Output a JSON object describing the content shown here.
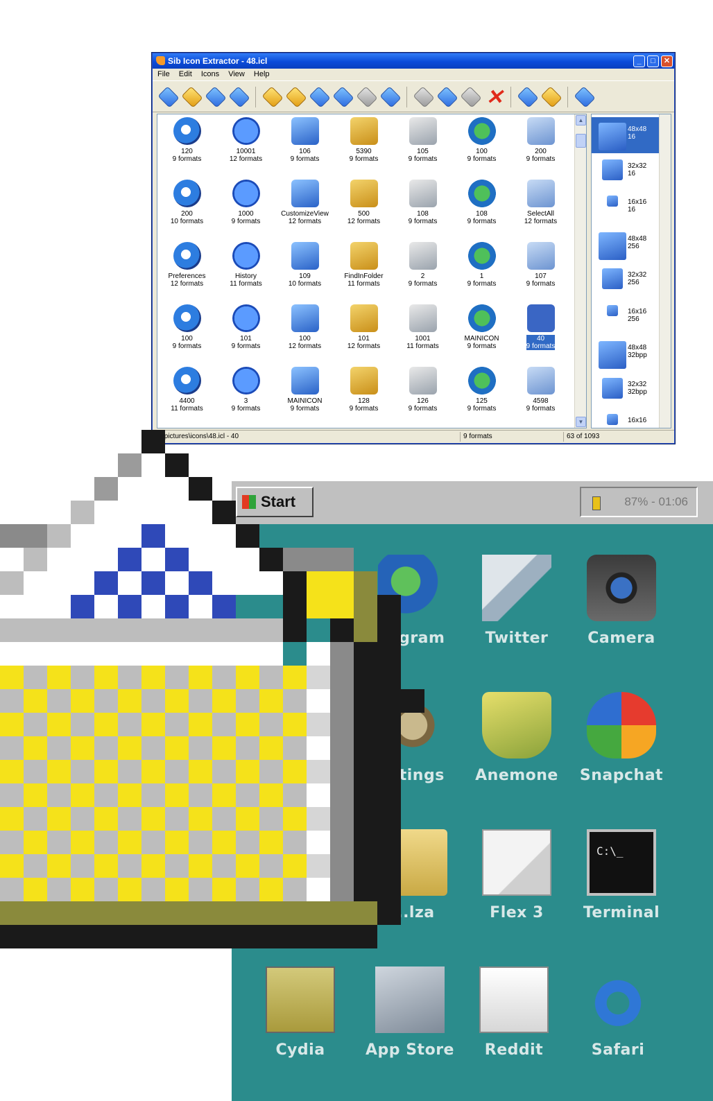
{
  "window": {
    "title": "Sib Icon Extractor - 48.icl",
    "menu": [
      "File",
      "Edit",
      "Icons",
      "View",
      "Help"
    ],
    "icons": [
      {
        "name": "120",
        "formats": "9 formats"
      },
      {
        "name": "10001",
        "formats": "12 formats"
      },
      {
        "name": "106",
        "formats": "9 formats"
      },
      {
        "name": "5390",
        "formats": "9 formats"
      },
      {
        "name": "105",
        "formats": "9 formats"
      },
      {
        "name": "100",
        "formats": "9 formats"
      },
      {
        "name": "200",
        "formats": "9 formats"
      },
      {
        "name": "200",
        "formats": "10 formats"
      },
      {
        "name": "1000",
        "formats": "9 formats"
      },
      {
        "name": "CustomizeView",
        "formats": "12 formats"
      },
      {
        "name": "500",
        "formats": "12 formats"
      },
      {
        "name": "108",
        "formats": "9 formats"
      },
      {
        "name": "108",
        "formats": "9 formats"
      },
      {
        "name": "SelectAll",
        "formats": "12 formats"
      },
      {
        "name": "Preferences",
        "formats": "12 formats"
      },
      {
        "name": "History",
        "formats": "11 formats"
      },
      {
        "name": "109",
        "formats": "10 formats"
      },
      {
        "name": "FindInFolder",
        "formats": "11 formats"
      },
      {
        "name": "2",
        "formats": "9 formats"
      },
      {
        "name": "1",
        "formats": "9 formats"
      },
      {
        "name": "107",
        "formats": "9 formats"
      },
      {
        "name": "100",
        "formats": "9 formats"
      },
      {
        "name": "101",
        "formats": "9 formats"
      },
      {
        "name": "100",
        "formats": "12 formats"
      },
      {
        "name": "101",
        "formats": "12 formats"
      },
      {
        "name": "1001",
        "formats": "11 formats"
      },
      {
        "name": "MAINICON",
        "formats": "9 formats"
      },
      {
        "name": "40",
        "formats": "9 formats"
      },
      {
        "name": "4400",
        "formats": "11 formats"
      },
      {
        "name": "3",
        "formats": "9 formats"
      },
      {
        "name": "MAINICON",
        "formats": "9 formats"
      },
      {
        "name": "128",
        "formats": "9 formats"
      },
      {
        "name": "126",
        "formats": "9 formats"
      },
      {
        "name": "125",
        "formats": "9 formats"
      },
      {
        "name": "4598",
        "formats": "9 formats"
      }
    ],
    "selected_index": 27,
    "formats": [
      {
        "size": "48x48",
        "depth": "16"
      },
      {
        "size": "32x32",
        "depth": "16"
      },
      {
        "size": "16x16",
        "depth": "16"
      },
      {
        "size": "48x48",
        "depth": "256"
      },
      {
        "size": "32x32",
        "depth": "256"
      },
      {
        "size": "16x16",
        "depth": "256"
      },
      {
        "size": "48x48",
        "depth": "32bpp"
      },
      {
        "size": "32x32",
        "depth": "32bpp"
      },
      {
        "size": "16x16",
        "depth": ""
      }
    ],
    "status": {
      "path": "D:\\pictures\\icons\\48.icl - 40",
      "formats": "9 formats",
      "count": "63 of 1093"
    }
  },
  "taskbar": {
    "start_label": "Start",
    "tray_text": "87% - 01:06"
  },
  "apps": [
    {
      "label": "...gram",
      "icon": "globe-film-icon"
    },
    {
      "label": "Twitter",
      "icon": "twitter-icon"
    },
    {
      "label": "Camera",
      "icon": "camera-icon"
    },
    {
      "label": "...tings",
      "icon": "gear-icon"
    },
    {
      "label": "Anemone",
      "icon": "anemone-icon"
    },
    {
      "label": "Snapchat",
      "icon": "snapchat-icon"
    },
    {
      "label": "...lza",
      "icon": "folder-icon"
    },
    {
      "label": "Flex 3",
      "icon": "flex-icon"
    },
    {
      "label": "Terminal",
      "icon": "terminal-icon"
    },
    {
      "label": "Cydia",
      "icon": "cydia-icon"
    },
    {
      "label": "App Store",
      "icon": "app-store-icon"
    },
    {
      "label": "Reddit",
      "icon": "reddit-icon"
    },
    {
      "label": "Safari",
      "icon": "safari-icon"
    }
  ],
  "terminal_prompt": "C:\\_",
  "colors": {
    "desktop_teal": "#2b8c8c",
    "xp_title_blue": "#0b4bd9",
    "selection_blue": "#316ac5",
    "pixel_yellow": "#f5e21a",
    "pixel_blue": "#2f49b8"
  }
}
